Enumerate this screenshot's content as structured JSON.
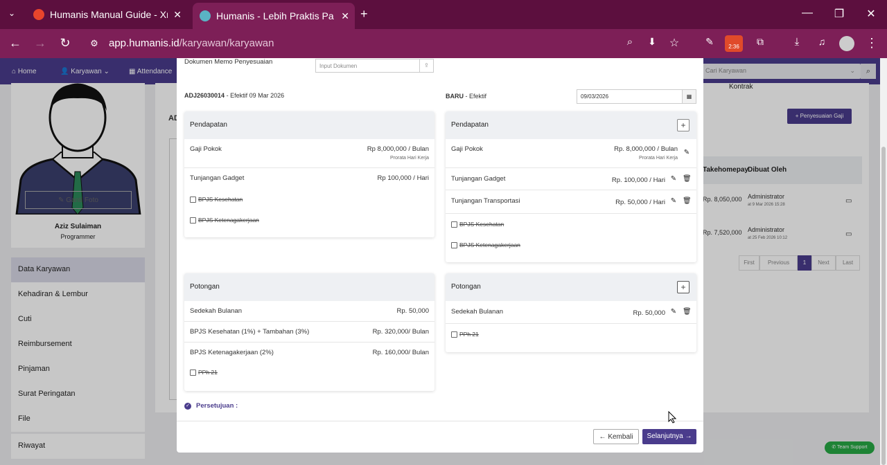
{
  "browser": {
    "tabs": [
      {
        "title": "Humanis Manual Guide - Xmind"
      },
      {
        "title": "Humanis - Lebih Praktis Pakai Humanis"
      }
    ],
    "url_domain": "app.humanis.id",
    "url_path": "/karyawan/karyawan",
    "badge": "2:36"
  },
  "nav": {
    "items": [
      "Home",
      "Karyawan",
      "Attendance"
    ],
    "search_placeholder": "Cari Karyawan"
  },
  "profile": {
    "change_photo": "Ganti Foto",
    "name": "Aziz Sulaiman",
    "position": "Programmer"
  },
  "sidebar": {
    "items": [
      "Data Karyawan",
      "Kehadiran & Lembur",
      "Cuti",
      "Reimbursement",
      "Pinjaman",
      "Surat Peringatan",
      "File",
      "Riwayat"
    ]
  },
  "background": {
    "kontrak": "Kontrak",
    "ad_label": "AD",
    "adjust_button": "Penyesuaian Gaji",
    "col_takehome": "Takehomepay",
    "col_creator": "Dibuat Oleh",
    "rows": [
      {
        "takehome": "Rp. 8,050,000",
        "creator": "Administrator",
        "date": "at 9 Mar 2026 15:28"
      },
      {
        "takehome": "Rp. 7,520,000",
        "creator": "Administrator",
        "date": "at 25 Feb 2026 10:12"
      }
    ],
    "pagination": [
      "First",
      "Previous",
      "1",
      "Next",
      "Last"
    ],
    "support": "Team Support"
  },
  "modal": {
    "doc_label": "Dokumen Memo Penyesuaian",
    "doc_placeholder": "Input Dokumen",
    "left_code": "ADJ26030014",
    "left_effective": "- Efektif 09 Mar 2026",
    "right_code": "BARU",
    "right_effective": "- Efektif",
    "right_date": "09/03/2026",
    "left_income": {
      "title": "Pendapatan",
      "gaji_label": "Gaji Pokok",
      "gaji_value": "Rp 8,000,000 / Bulan",
      "gaji_note": "Prorata Hari Kerja",
      "gadget_label": "Tunjangan Gadget",
      "gadget_value": "Rp 100,000 / Hari",
      "bpjs_kes": "BPJS Kesehatan",
      "bpjs_tk": "BPJS Ketenagakerjaan"
    },
    "right_income": {
      "title": "Pendapatan",
      "gaji_label": "Gaji Pokok",
      "gaji_value": "Rp. 8,000,000 / Bulan",
      "gaji_note": "Prorata Hari Kerja",
      "gadget_label": "Tunjangan Gadget",
      "gadget_value": "Rp. 100,000 / Hari",
      "transport_label": "Tunjangan Transportasi",
      "transport_value": "Rp. 50,000 / Hari",
      "bpjs_kes": "BPJS Kesehatan",
      "bpjs_tk": "BPJS Ketenagakerjaan"
    },
    "left_deduction": {
      "title": "Potongan",
      "sedekah_label": "Sedekah Bulanan",
      "sedekah_value": "Rp. 50,000",
      "bpjs_kes_label": "BPJS Kesehatan (1%) + Tambahan (3%)",
      "bpjs_kes_value": "Rp. 320,000/ Bulan",
      "bpjs_tk_label": "BPJS Ketenagakerjaan (2%)",
      "bpjs_tk_value": "Rp. 160,000/ Bulan",
      "pph": "PPh 21"
    },
    "right_deduction": {
      "title": "Potongan",
      "sedekah_label": "Sedekah Bulanan",
      "sedekah_value": "Rp. 50,000",
      "pph": "PPh 21"
    },
    "approval": "Persetujuan :",
    "back_button": "← Kembali",
    "next_button": "Selanjutnya →"
  },
  "colors": {
    "brand": "#4a3c8c",
    "chrome": "#7d1f57"
  }
}
